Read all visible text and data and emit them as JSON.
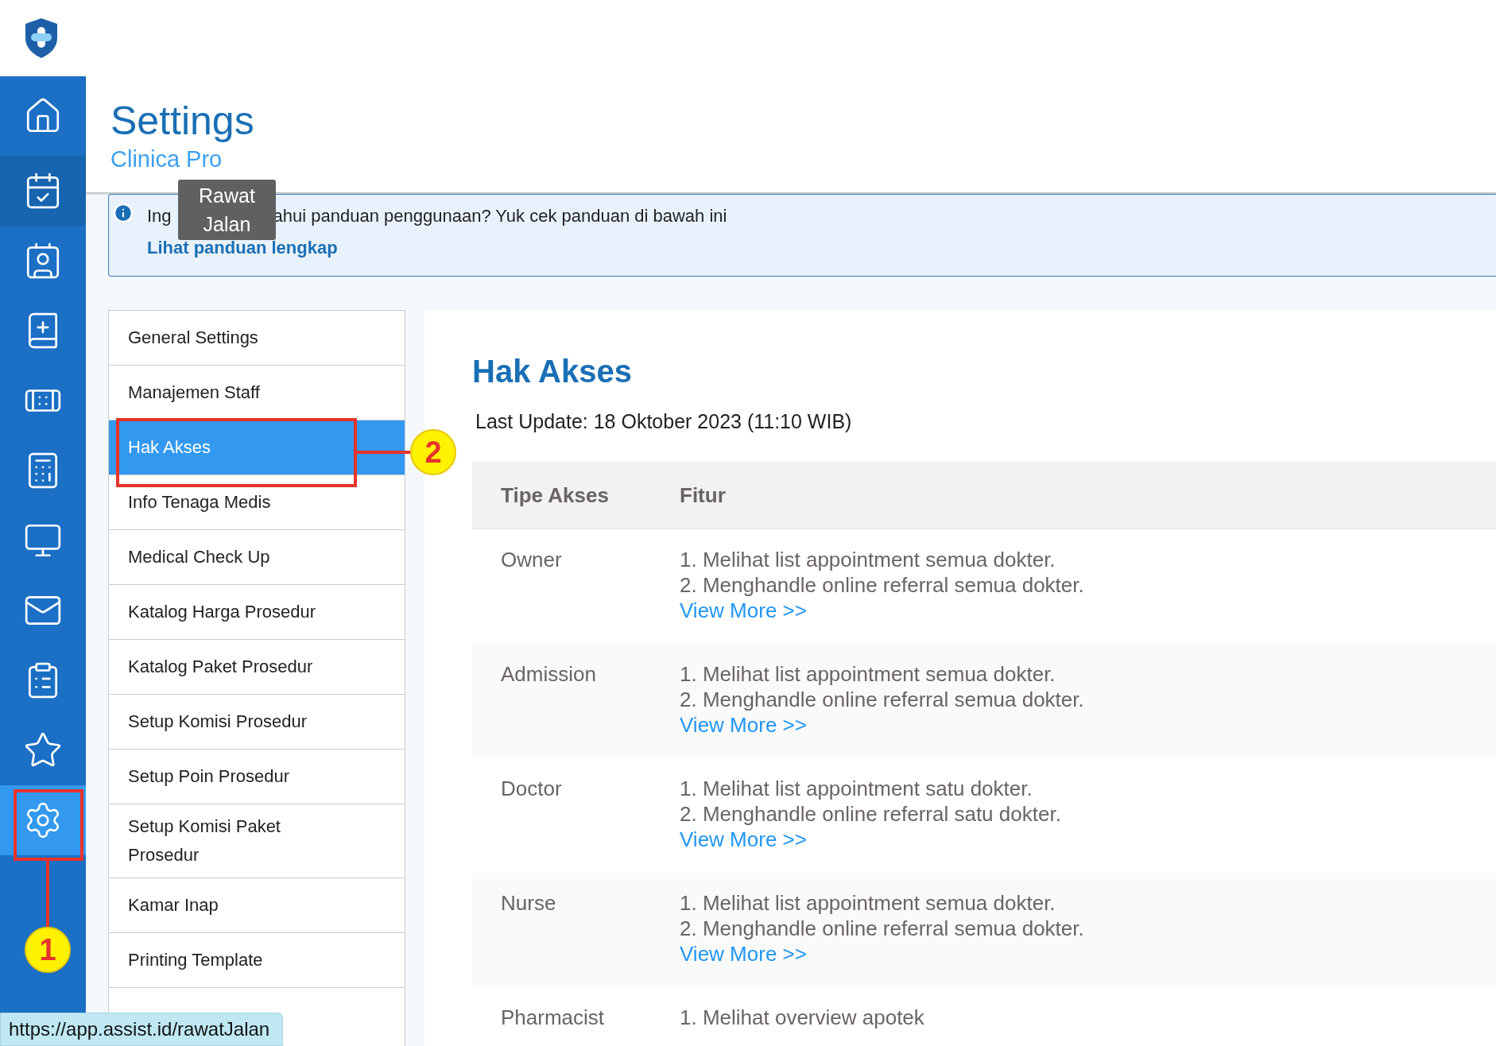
{
  "sidebar": [
    {
      "kind": "home",
      "selected": false,
      "hovered": false
    },
    {
      "kind": "calendar",
      "selected": false,
      "hovered": true
    },
    {
      "kind": "id-card",
      "selected": false,
      "hovered": false
    },
    {
      "kind": "medical-book",
      "selected": false,
      "hovered": false
    },
    {
      "kind": "bandage",
      "selected": false,
      "hovered": false
    },
    {
      "kind": "register",
      "selected": false,
      "hovered": false
    },
    {
      "kind": "monitor",
      "selected": false,
      "hovered": false
    },
    {
      "kind": "mail",
      "selected": false,
      "hovered": false
    },
    {
      "kind": "clipboard",
      "selected": false,
      "hovered": false
    },
    {
      "kind": "star",
      "selected": false,
      "hovered": false
    },
    {
      "kind": "settings",
      "selected": true,
      "hovered": false
    }
  ],
  "header": {
    "title": "Settings",
    "subtitle": "Clinica Pro"
  },
  "tooltip": "Rawat Jalan",
  "banner": {
    "message_before_tooltip": "Ing",
    "message_after_tooltip": "ahui panduan penggunaan? Yuk cek panduan di bawah ini",
    "link": "Lihat panduan lengkap"
  },
  "settings_menu": [
    {
      "label": "General Settings",
      "selected": false
    },
    {
      "label": "Manajemen Staff",
      "selected": false
    },
    {
      "label": "Hak Akses",
      "selected": true
    },
    {
      "label": "Info Tenaga Medis",
      "selected": false
    },
    {
      "label": "Medical Check Up",
      "selected": false
    },
    {
      "label": "Katalog Harga Prosedur",
      "selected": false
    },
    {
      "label": "Katalog Paket Prosedur",
      "selected": false
    },
    {
      "label": "Setup Komisi Prosedur",
      "selected": false
    },
    {
      "label": "Setup Poin Prosedur",
      "selected": false
    },
    {
      "label": "Setup Komisi Paket Prosedur",
      "selected": false
    },
    {
      "label": "Kamar Inap",
      "selected": false
    },
    {
      "label": "Printing Template",
      "selected": false
    }
  ],
  "panel": {
    "title": "Hak Akses",
    "last_update": "Last Update: 18 Oktober 2023 (11:10 WIB)",
    "table": {
      "columns": [
        "Tipe Akses",
        "Fitur"
      ],
      "rows": [
        {
          "type": "Owner",
          "features": [
            "1. Melihat list appointment semua dokter.",
            "2. Menghandle online referral semua dokter."
          ],
          "link": "View More >>"
        },
        {
          "type": "Admission",
          "features": [
            "1. Melihat list appointment semua dokter.",
            "2. Menghandle online referral semua dokter."
          ],
          "link": "View More >>"
        },
        {
          "type": "Doctor",
          "features": [
            "1. Melihat list appointment satu dokter.",
            "2. Menghandle online referral satu dokter."
          ],
          "link": "View More >>"
        },
        {
          "type": "Nurse",
          "features": [
            "1. Melihat list appointment semua dokter.",
            "2. Menghandle online referral semua dokter."
          ],
          "link": "View More >>"
        },
        {
          "type": "Pharmacist",
          "features": [
            "1. Melihat overview apotek"
          ]
        }
      ]
    }
  },
  "callouts": [
    {
      "label": "1"
    },
    {
      "label": "2"
    }
  ],
  "status_url": "https://app.assist.id/rawatJalan"
}
